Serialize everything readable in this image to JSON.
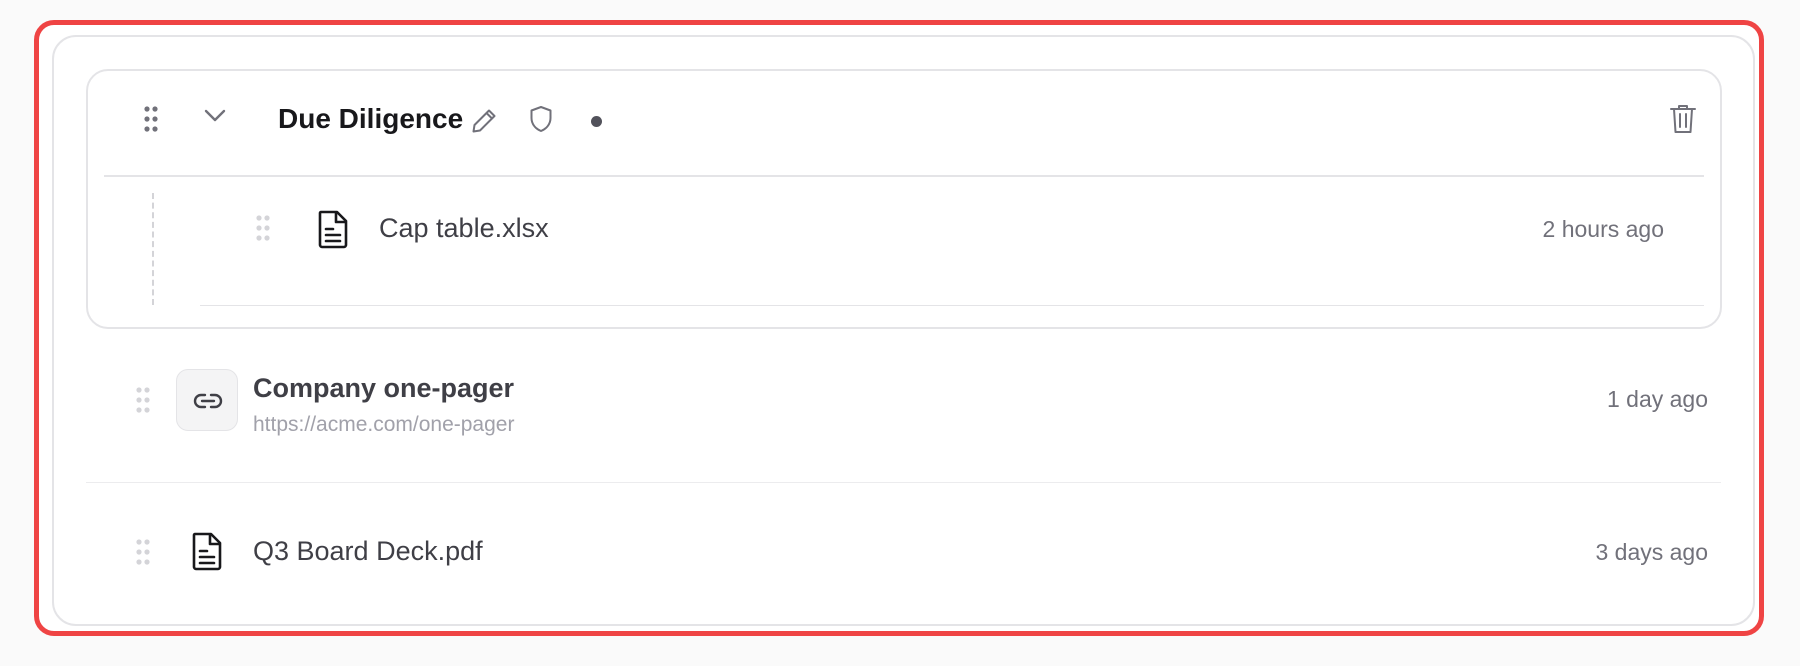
{
  "folder": {
    "title": "Due Diligence",
    "icons": [
      "drag-handle-icon",
      "chevron-down-icon",
      "pencil-icon",
      "shield-icon",
      "trash-icon"
    ],
    "items": [
      {
        "name": "Cap table.xlsx",
        "icon": "document-icon",
        "time": "2 hours ago"
      }
    ]
  },
  "items": [
    {
      "name": "Company one-pager",
      "url": "https://acme.com/one-pager",
      "icon": "link-icon",
      "time": "1 day ago"
    },
    {
      "name": "Q3 Board Deck.pdf",
      "icon": "document-icon",
      "time": "3 days ago"
    }
  ],
  "colors": {
    "highlight_border": "#ef4444",
    "card_border": "#e4e4e7",
    "muted_text": "#71717a",
    "url_text": "#a1a1aa"
  }
}
